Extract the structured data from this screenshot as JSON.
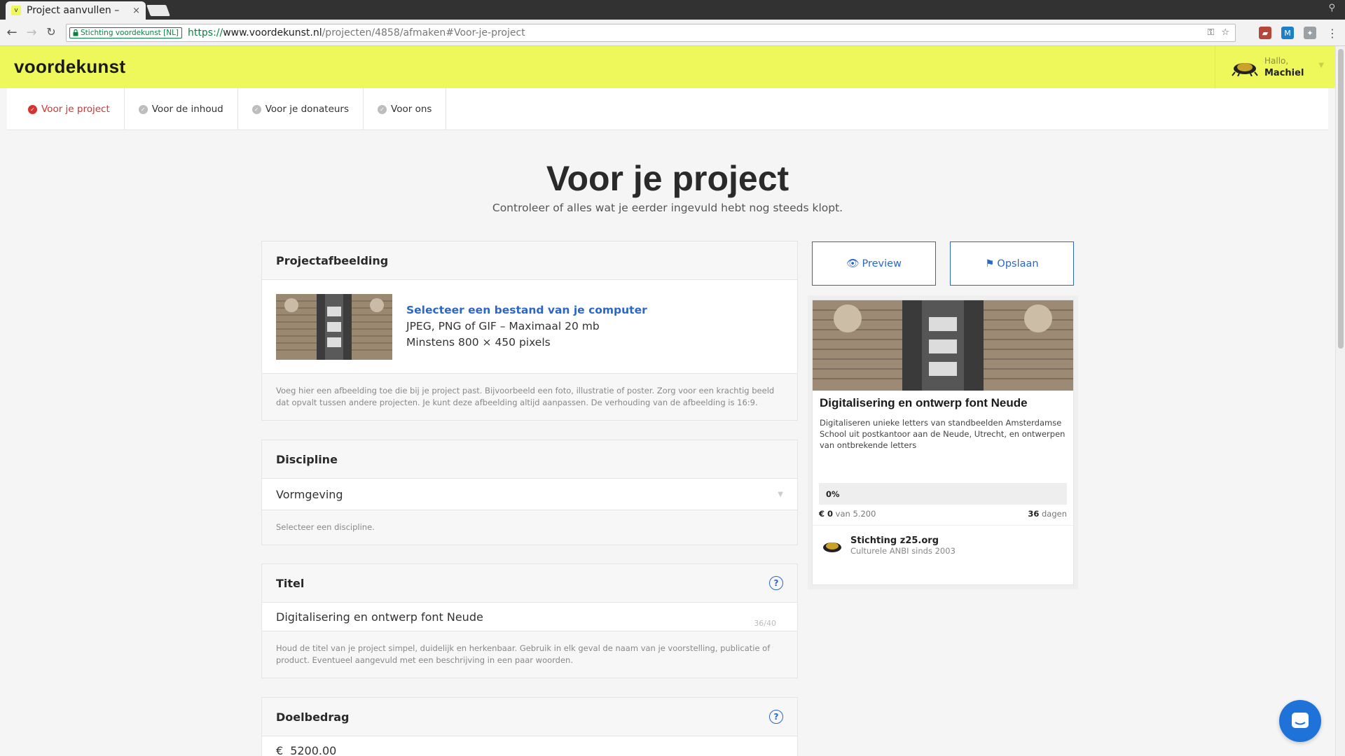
{
  "browser": {
    "tab_title": "Project aanvullen –",
    "tab_close": "×",
    "cert_label": "Stichting voordekunst [NL]",
    "url_scheme": "https://",
    "url_host": "www.voordekunst.nl",
    "url_path": "/projecten/4858/afmaken#Voor-je-project",
    "window_user": "⚲"
  },
  "header": {
    "logo": "voordekunst",
    "greeting": "Hallo,",
    "user_name": "Machiel"
  },
  "subnav": {
    "items": [
      {
        "label": "Voor je project"
      },
      {
        "label": "Voor de inhoud"
      },
      {
        "label": "Voor je donateurs"
      },
      {
        "label": "Voor ons"
      }
    ]
  },
  "page": {
    "title": "Voor je project",
    "subtitle": "Controleer of alles wat je eerder ingevuld hebt nog steeds klopt."
  },
  "projectafbeelding": {
    "heading": "Projectafbeelding",
    "upload_link": "Selecteer een bestand van je computer",
    "formats": "JPEG, PNG of GIF – Maximaal 20 mb",
    "min_size": "Minstens 800 × 450 pixels",
    "hint": "Voeg hier een afbeelding toe die bij je project past. Bijvoorbeeld een foto, illustratie of poster. Zorg voor een krachtig beeld dat opvalt tussen andere projecten. Je kunt deze afbeelding altijd aanpassen. De verhouding van de afbeelding is 16:9."
  },
  "discipline": {
    "heading": "Discipline",
    "selected": "Vormgeving",
    "hint": "Selecteer een discipline."
  },
  "titel": {
    "heading": "Titel",
    "value": "Digitalisering en ontwerp font Neude",
    "char_count": "36/40",
    "hint": "Houd de titel van je project simpel, duidelijk en herkenbaar. Gebruik in elk geval de naam van je voorstelling, publicatie of product. Eventueel aangevuld met een beschrijving in een paar woorden."
  },
  "doelbedrag": {
    "heading": "Doelbedrag",
    "currency": "€",
    "value": "5200.00"
  },
  "actions": {
    "preview": "Preview",
    "save": "Opslaan"
  },
  "card": {
    "title": "Digitalisering en ontwerp font Neude",
    "description": "Digitaliseren unieke letters van standbeelden Amsterdamse School uit postkantoor aan de Neude, Utrecht, en ontwerpen van ontbrekende letters",
    "progress": 0,
    "progress_label": "0%",
    "raised": "€ 0",
    "raised_suffix": "van 5.200",
    "days": "36",
    "days_suffix": "dagen",
    "org_name": "Stichting z25.org",
    "org_sub": "Culturele ANBI sinds 2003"
  },
  "colors": {
    "brand_yellow": "#eef85a",
    "accent_blue": "#2b67c9",
    "active_red": "#d6322f"
  }
}
